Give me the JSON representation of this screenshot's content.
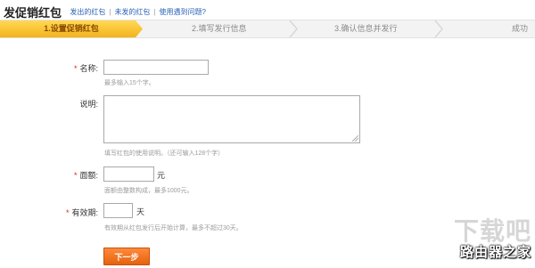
{
  "header": {
    "title": "发促销红包",
    "links": [
      "发出的红包",
      "未发的红包",
      "使用遇到问题?"
    ]
  },
  "steps": [
    {
      "label": "1.设置促销红包",
      "active": true
    },
    {
      "label": "2.填写发行信息",
      "active": false
    },
    {
      "label": "3.确认信息并发行",
      "active": false
    },
    {
      "label": "成功",
      "active": false
    }
  ],
  "form": {
    "name": {
      "label": "名称:",
      "required": true,
      "value": "",
      "hint": "最多输入15个字。"
    },
    "description": {
      "label": "说明:",
      "required": false,
      "value": "",
      "hint": "填写红包的使用说明。（还可输入128个字）"
    },
    "amount": {
      "label": "面额:",
      "required": true,
      "value": "",
      "unit": "元",
      "hint": "面额由整数构成，最多1000元。"
    },
    "validity": {
      "label": "有效期:",
      "required": true,
      "value": "",
      "unit": "天",
      "hint": "有效期从红包发行后开始计算，最多不超过30天。"
    }
  },
  "next_button": {
    "label": "下一步"
  },
  "watermark": {
    "top": "下载吧",
    "bottom": "路由器之家"
  },
  "colors": {
    "accent": "#f4b21d",
    "button": "#e5620c",
    "link": "#2a62b8",
    "required": "#e02020"
  }
}
